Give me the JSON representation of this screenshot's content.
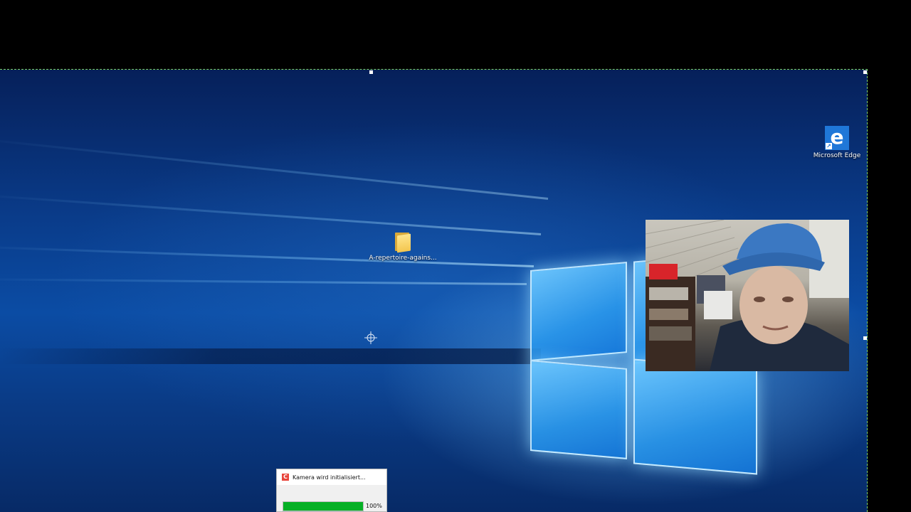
{
  "desktop": {
    "icons": [
      {
        "label": "Microsoft Edge",
        "icon": "edge-icon"
      },
      {
        "label": "A-repertoire-agains...",
        "icon": "folder-icon"
      }
    ],
    "wallpaper_colors": {
      "deep": "#06205a",
      "mid": "#0b4ca4",
      "glow": "#78c8ff"
    }
  },
  "recorder": {
    "title": "Kamera wird initialisiert...",
    "progress": 1.0,
    "progress_label": "100%",
    "progress_color": "#06b025",
    "logo_icon": "camtasia-logo-icon"
  },
  "webcam": {
    "description_icon": "webcam-feed"
  },
  "cursor": {
    "icon": "crosshair-icon"
  },
  "selection": {
    "border_color": "#7fd36a"
  }
}
